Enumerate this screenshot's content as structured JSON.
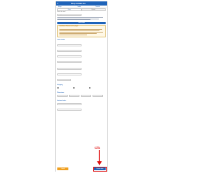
{
  "app": {
    "title": "Shop installed Pro"
  },
  "nav": {
    "left": "Shops",
    "middle": "Toolkit",
    "right": "Tutorials"
  },
  "tabs": [
    {
      "label": "Shop"
    },
    {
      "label": "Upload"
    }
  ],
  "sections": {
    "store": "Select the store/...",
    "order": "Order details",
    "shipping": "Shipping",
    "dimensions": "Dimensions",
    "value": "Declared value"
  },
  "fields": {
    "shop_value": "Shopify",
    "user_value": "Tim Lemaitre",
    "ref_value": "Order 1234",
    "name_value": "Pascale Petit",
    "phone_value": "0655443322",
    "amount_value": "100",
    "currency_value": "EUR",
    "qty_value": "1",
    "weight_value": "0.5",
    "declared_value": "110",
    "ref2_value": "X12000"
  },
  "notice": {
    "title": "Installation: Welcome to this plugin!"
  },
  "buttons": {
    "left": "Cancel",
    "right": "Create order"
  },
  "annotation": {
    "clic": "Clic"
  },
  "colors": {
    "brand": "#1e63b9",
    "highlight": "#e01010",
    "warning": "#f0a020"
  }
}
